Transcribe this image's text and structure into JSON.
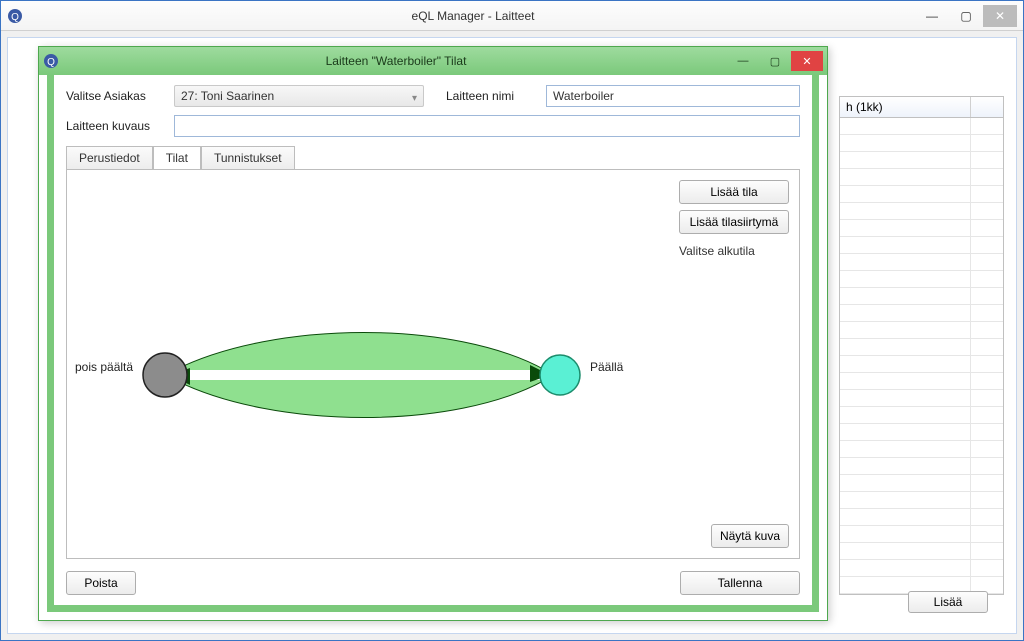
{
  "mainwindow": {
    "title": "eQL Manager - Laitteet",
    "right_table_header": "h (1kk)",
    "add_button": "Lisää"
  },
  "dialog": {
    "title": "Laitteen \"Waterboiler\" Tilat",
    "form": {
      "valitse_asiakas_label": "Valitse Asiakas",
      "customer_value": "27: Toni Saarinen",
      "laitteen_nimi_label": "Laitteen nimi",
      "laitteen_nimi_value": "Waterboiler",
      "laitteen_kuvaus_label": "Laitteen kuvaus",
      "laitteen_kuvaus_value": ""
    },
    "tabs": {
      "perustiedot": "Perustiedot",
      "tilat": "Tilat",
      "tunnistukset": "Tunnistukset"
    },
    "side": {
      "lisaa_tila": "Lisää tila",
      "lisaa_tilasiirtyma": "Lisää tilasiirtymä",
      "valitse_alkutila": "Valitse alkutila",
      "nayta_kuva": "Näytä kuva"
    },
    "footer": {
      "poista": "Poista",
      "tallenna": "Tallenna"
    },
    "states": {
      "off_label": "pois päältä",
      "on_label": "Päällä"
    }
  }
}
